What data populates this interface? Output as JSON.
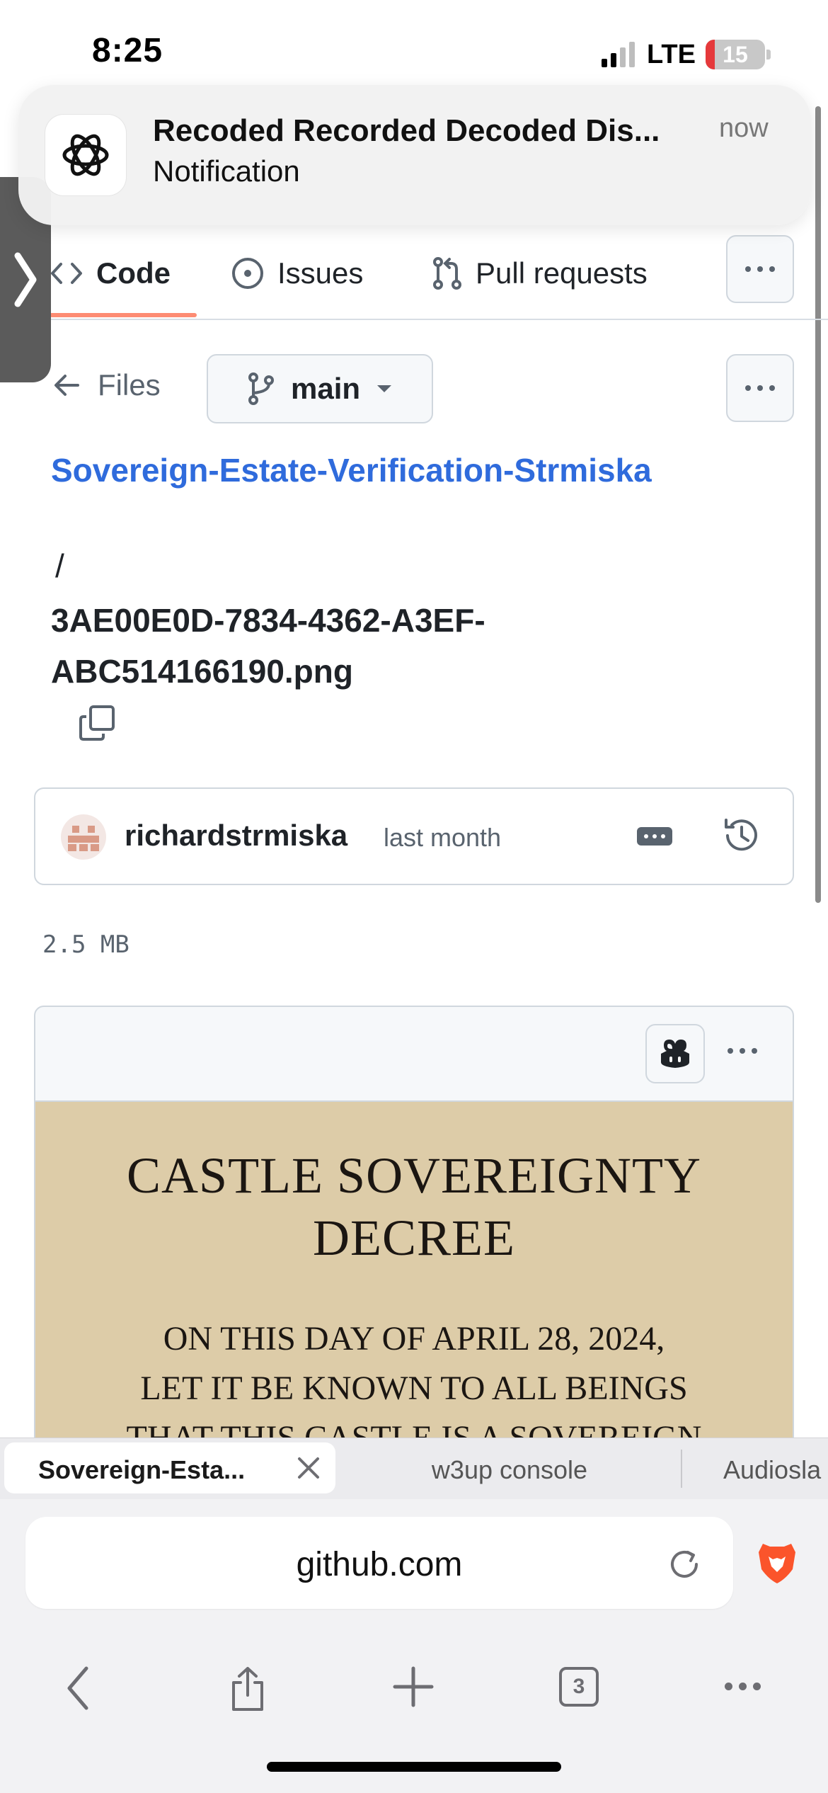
{
  "status_bar": {
    "time": "8:25",
    "network": "LTE",
    "battery": "15"
  },
  "notification": {
    "title": "Recoded Recorded Decoded Dis...",
    "subtitle": "Notification",
    "time": "now"
  },
  "repo_nav": {
    "tabs": [
      {
        "label": "Code",
        "icon": "code-icon",
        "active": true
      },
      {
        "label": "Issues",
        "icon": "issue-opened-icon"
      },
      {
        "label": "Pull requests",
        "icon": "git-pull-request-icon"
      }
    ]
  },
  "files_bar": {
    "back_label": "Files",
    "branch": "main"
  },
  "breadcrumb": {
    "repo": "Sovereign-Estate-Verification-Strmiska",
    "separator": "/",
    "file": "3AE00E0D-7834-4362-A3EF-ABC514166190.png"
  },
  "commit": {
    "author": "richardstrmiska",
    "time": "last month"
  },
  "file_size": "2.5 MB",
  "preview": {
    "title": "CASTLE SOVEREIGNTY DECREE",
    "lines": [
      "ON THIS DAY OF APRIL 28, 2024,",
      "LET IT BE KNOWN TO ALL BEINGS",
      "THAT THIS CASTLE IS A SOVEREIGN"
    ]
  },
  "browser": {
    "tabs": [
      {
        "label": "Sovereign-Esta...",
        "active": true
      },
      {
        "label": "w3up console"
      },
      {
        "label": "Audiosla"
      }
    ],
    "url": "github.com",
    "tab_count": "3"
  },
  "colors": {
    "link": "#2f6bdc",
    "active_tab_underline": "#fd8c73",
    "decree_paper": "#ddcca8",
    "brave_orange": "#fb542b"
  }
}
